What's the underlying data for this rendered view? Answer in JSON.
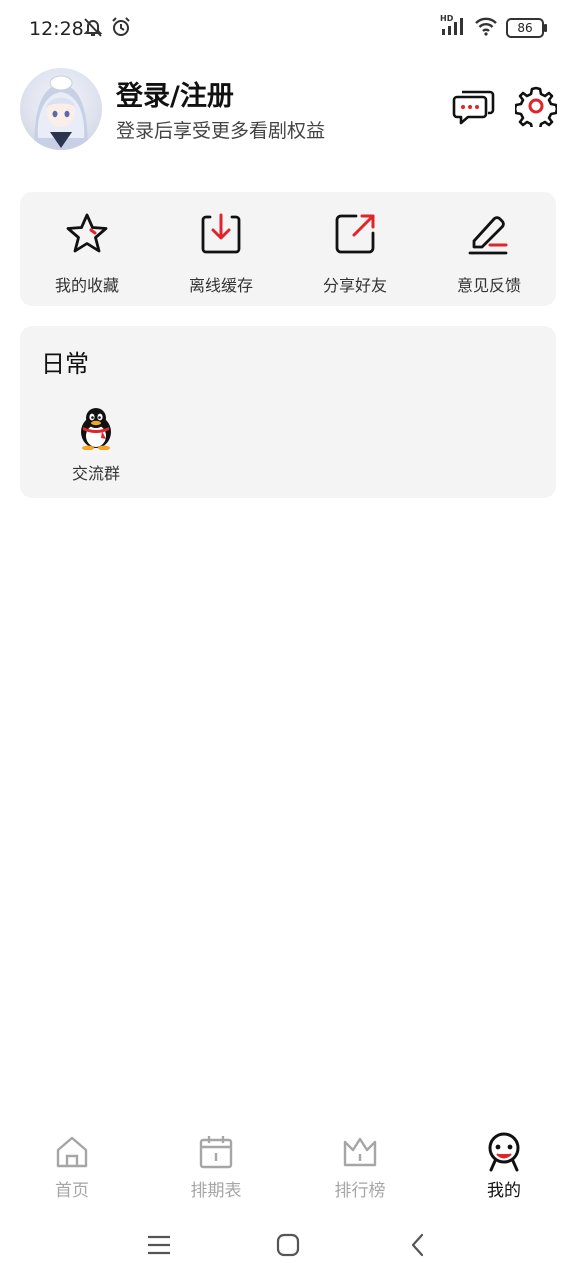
{
  "status_bar": {
    "time": "12:28",
    "network_label": "HD",
    "battery": "86"
  },
  "header": {
    "title": "登录/注册",
    "subtitle": "登录后享受更多看剧权益"
  },
  "quick_actions": [
    {
      "label": "我的收藏",
      "icon": "star-icon"
    },
    {
      "label": "离线缓存",
      "icon": "download-icon"
    },
    {
      "label": "分享好友",
      "icon": "share-icon"
    },
    {
      "label": "意见反馈",
      "icon": "edit-feedback-icon"
    }
  ],
  "daily": {
    "title": "日常",
    "items": [
      {
        "label": "交流群",
        "icon": "qq-penguin-icon"
      }
    ]
  },
  "tabbar": [
    {
      "label": "首页",
      "icon": "home-icon",
      "active": false
    },
    {
      "label": "排期表",
      "icon": "calendar-icon",
      "active": false
    },
    {
      "label": "排行榜",
      "icon": "crown-icon",
      "active": false
    },
    {
      "label": "我的",
      "icon": "profile-face-icon",
      "active": true
    }
  ],
  "colors": {
    "accent": "#e0242b",
    "card_bg": "#f4f4f4",
    "inactive": "#a6a6a6"
  }
}
